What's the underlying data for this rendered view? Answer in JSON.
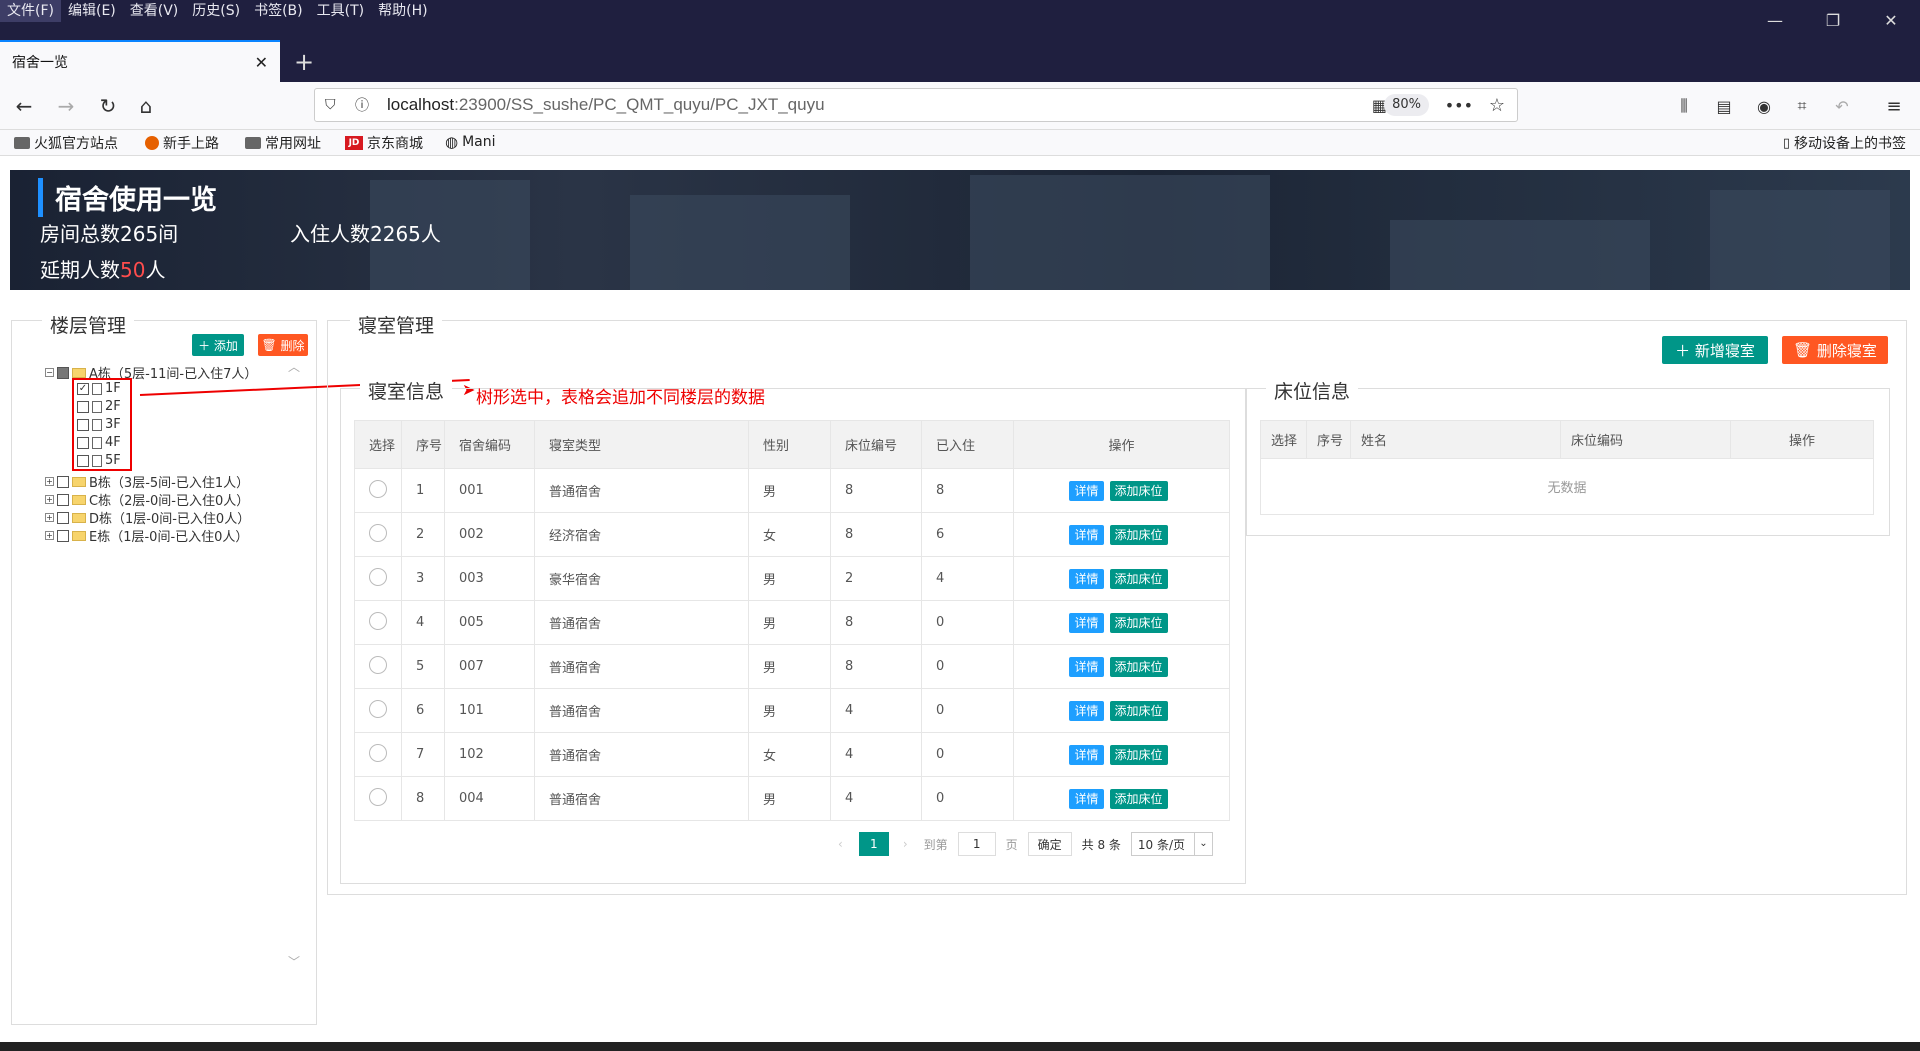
{
  "browser": {
    "menu": [
      "文件(F)",
      "编辑(E)",
      "查看(V)",
      "历史(S)",
      "书签(B)",
      "工具(T)",
      "帮助(H)"
    ],
    "tab_title": "宿舍一览",
    "url_host": "localhost",
    "url_path": ":23900/SS_sushe/PC_QMT_quyu/PC_JXT_quyu",
    "zoom": "80%",
    "bookmarks": [
      "火狐官方站点",
      "新手上路",
      "常用网址",
      "京东商城",
      "Mani"
    ],
    "mobile_bookmarks": "移动设备上的书签"
  },
  "banner": {
    "title": "宿舍使用一览",
    "rooms": "房间总数265间",
    "residents": "入住人数2265人",
    "delay_prefix": "延期人数",
    "delay_count": "50",
    "delay_suffix": "人"
  },
  "floor_panel": {
    "title": "楼层管理",
    "add": "添加",
    "delete": "删除",
    "tree": [
      {
        "label": "A栋（5层-11间-已入住7人）",
        "expanded": true,
        "children": [
          "1F",
          "2F",
          "3F",
          "4F",
          "5F"
        ],
        "checked_children": [
          "1F"
        ]
      },
      {
        "label": "B栋（3层-5间-已入住1人）"
      },
      {
        "label": "C栋（2层-0间-已入住0人）"
      },
      {
        "label": "D栋（1层-0间-已入住0人）"
      },
      {
        "label": "E栋（1层-0间-已入住0人）"
      }
    ]
  },
  "room_panel": {
    "title": "寝室管理",
    "new_room": "新增寝室",
    "delete_room": "删除寝室",
    "info_title": "寝室信息",
    "annotation": "树形选中，表格会追加不同楼层的数据",
    "columns": [
      "选择",
      "序号",
      "宿舍编码",
      "寝室类型",
      "性别",
      "床位编号",
      "已入住",
      "操作"
    ],
    "rows": [
      [
        "1",
        "001",
        "普通宿舍",
        "男",
        "8",
        "8"
      ],
      [
        "2",
        "002",
        "经济宿舍",
        "女",
        "8",
        "6"
      ],
      [
        "3",
        "003",
        "豪华宿舍",
        "男",
        "2",
        "4"
      ],
      [
        "4",
        "005",
        "普通宿舍",
        "男",
        "8",
        "0"
      ],
      [
        "5",
        "007",
        "普通宿舍",
        "男",
        "8",
        "0"
      ],
      [
        "6",
        "101",
        "普通宿舍",
        "男",
        "4",
        "0"
      ],
      [
        "7",
        "102",
        "普通宿舍",
        "女",
        "4",
        "0"
      ],
      [
        "8",
        "004",
        "普通宿舍",
        "男",
        "4",
        "0"
      ]
    ],
    "detail_btn": "详情",
    "add_bed_btn": "添加床位",
    "pager": {
      "current": "1",
      "goto": "到第",
      "page_input": "1",
      "page": "页",
      "confirm": "确定",
      "total": "共 8 条",
      "per_page": "10 条/页"
    }
  },
  "bed_panel": {
    "title": "床位信息",
    "columns": [
      "选择",
      "序号",
      "姓名",
      "床位编码",
      "操作"
    ],
    "empty": "无数据"
  }
}
